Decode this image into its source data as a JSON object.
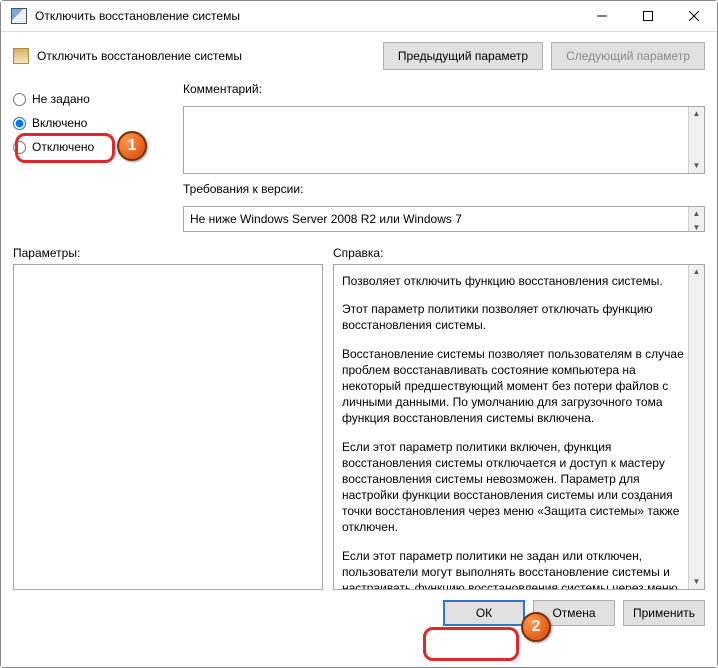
{
  "window": {
    "title": "Отключить восстановление системы",
    "subtitle": "Отключить восстановление системы",
    "prev": "Предыдущий параметр",
    "next": "Следующий параметр"
  },
  "radios": {
    "not_configured": "Не задано",
    "enabled": "Включено",
    "disabled": "Отключено"
  },
  "labels": {
    "comment": "Комментарий:",
    "requirements": "Требования к версии:",
    "options": "Параметры:",
    "help": "Справка:"
  },
  "requirements_text": "Не ниже Windows Server 2008 R2 или Windows 7",
  "help": {
    "p1": "Позволяет отключить функцию восстановления системы.",
    "p2": "Этот параметр политики позволяет отключать функцию восстановления системы.",
    "p3": "Восстановление системы позволяет пользователям в случае проблем восстанавливать состояние компьютера на некоторый предшествующий момент без потери файлов с личными данными. По умолчанию для загрузочного тома функция восстановления системы включена.",
    "p4": "Если этот параметр политики включен, функция восстановления системы отключается и доступ к мастеру восстановления системы невозможен. Параметр для настройки функции восстановления системы или создания точки восстановления через меню «Защита системы» также отключен.",
    "p5": "Если этот параметр политики не задан или отключен, пользователи могут выполнять восстановление системы и настраивать функцию восстановления системы через меню"
  },
  "buttons": {
    "ok": "ОК",
    "cancel": "Отмена",
    "apply": "Применить"
  },
  "badges": {
    "b1": "1",
    "b2": "2"
  }
}
